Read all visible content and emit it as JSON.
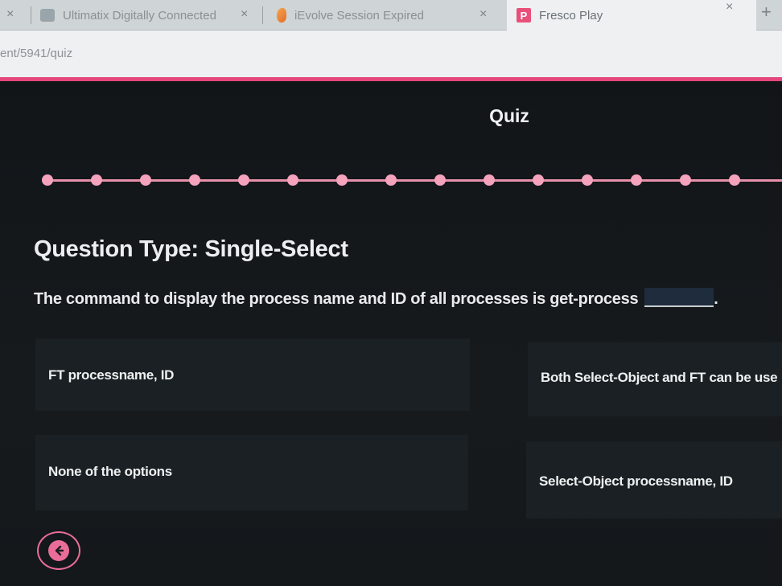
{
  "browser": {
    "tabs": [
      {
        "title": "Ultimatix Digitally Connected",
        "active": false
      },
      {
        "title": "iEvolve Session Expired",
        "active": false
      },
      {
        "title": "Fresco Play",
        "active": true
      }
    ],
    "close_glyph": "×",
    "new_tab_glyph": "+",
    "url": "ent/5941/quiz",
    "accent_color": "#e4457a"
  },
  "page": {
    "title": "Quiz"
  },
  "progress": {
    "total_questions": 15
  },
  "question": {
    "type_label": "Question Type: Single-Select",
    "text": "The command to display the process name and ID of all processes is get-process",
    "options": [
      "FT processname, ID",
      "Both Select-Object and FT can be use",
      "None of the options",
      "Select-Object processname, ID"
    ]
  },
  "icons": {
    "back": "arrow-left-icon",
    "tab_close": "close-icon",
    "new_tab": "plus-icon"
  }
}
